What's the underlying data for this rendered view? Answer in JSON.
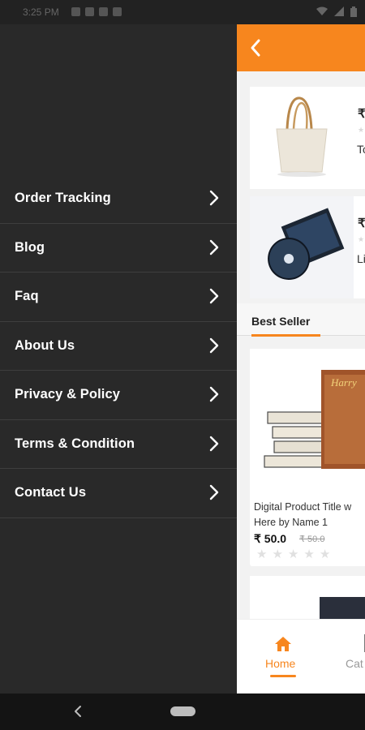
{
  "status_bar": {
    "time": "3:25 PM",
    "indicators": [
      "wifi-icon",
      "signal-icon",
      "battery-icon"
    ]
  },
  "drawer": {
    "items": [
      {
        "label": "Order Tracking"
      },
      {
        "label": "Blog"
      },
      {
        "label": "Faq"
      },
      {
        "label": "About Us"
      },
      {
        "label": "Privacy & Policy"
      },
      {
        "label": "Terms & Condition"
      },
      {
        "label": "Contact Us"
      }
    ]
  },
  "main": {
    "cart_items": [
      {
        "price": "₹",
        "desc": "Tc a"
      },
      {
        "price": "₹",
        "desc": "Li a"
      }
    ],
    "section_tab": "Best Seller",
    "product": {
      "title": "Digital Product Title w Here by Name 1",
      "price": "₹ 50.0",
      "old_price": "₹ 50.0",
      "rating": 0
    },
    "bottom_nav": {
      "home": "Home",
      "categories": "Cat"
    }
  },
  "colors": {
    "accent": "#f7861e",
    "drawer_bg": "#292929"
  }
}
